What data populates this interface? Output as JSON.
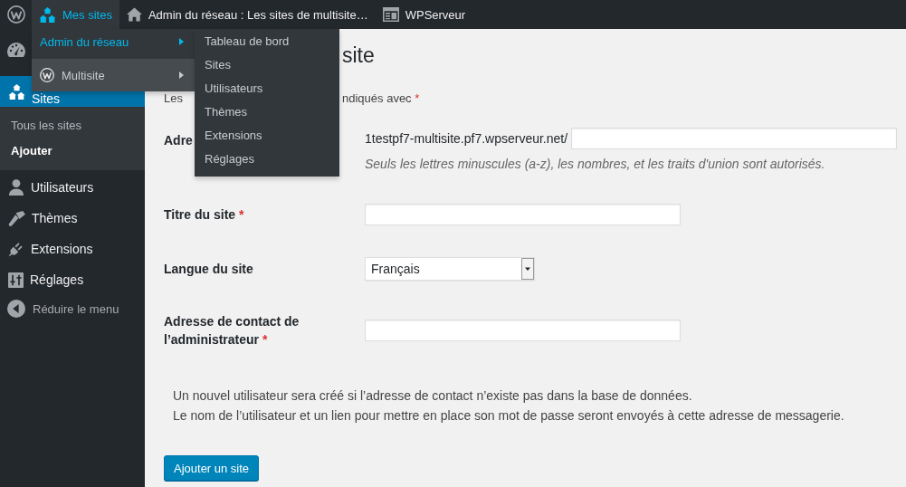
{
  "admin_bar": {
    "items": [
      {
        "label": "Mes sites",
        "selected": true
      },
      {
        "label": "Admin du réseau : Les sites de multisite…",
        "selected": false
      },
      {
        "label": "WPServeur",
        "selected": false
      }
    ]
  },
  "sites_menu": {
    "items": [
      {
        "kind": "network",
        "label": "Admin du réseau",
        "selected": true
      },
      {
        "kind": "site",
        "label": "Multisite",
        "selected": false
      }
    ]
  },
  "network_menu": {
    "items": [
      "Tableau de bord",
      "Sites",
      "Utilisateurs",
      "Thèmes",
      "Extensions",
      "Réglages"
    ]
  },
  "sidebar": {
    "items": [
      {
        "label": "Sites",
        "selected": true,
        "children": [
          {
            "label": "Tous les sites",
            "selected": false
          },
          {
            "label": "Ajouter",
            "selected": true
          }
        ]
      },
      {
        "label": "Utilisateurs",
        "selected": false
      },
      {
        "label": "Thèmes",
        "selected": false
      },
      {
        "label": "Extensions",
        "selected": false
      },
      {
        "label": "Réglages",
        "selected": false
      }
    ],
    "collapse_label": "Réduire le menu"
  },
  "page": {
    "title": "site",
    "required_note": {
      "start": "Les",
      "end": "ndiqués avec",
      "mark": "*"
    },
    "fields": [
      {
        "kind": "url",
        "label": "Adre",
        "prefix": "1testpf7-multisite.pf7.wpserveur.net/",
        "description": "Seuls les lettres minuscules (a-z), les nombres, et les traits d'union sont autorisés."
      },
      {
        "kind": "text",
        "label": "Titre du site",
        "required_mark": "*"
      },
      {
        "kind": "select",
        "label": "Langue du site",
        "value": "Français"
      },
      {
        "kind": "text",
        "label": "Adresse de contact de l’administrateur",
        "required_mark": "*"
      }
    ],
    "notice_lines": [
      "Un nouvel utilisateur sera créé si l’adresse de contact n’existe pas dans la base de données.",
      "Le nom de l’utilisateur et un lien pour mettre en place son mot de passe seront envoyés à cette adresse de messagerie."
    ],
    "submit_label": "Ajouter un site"
  }
}
